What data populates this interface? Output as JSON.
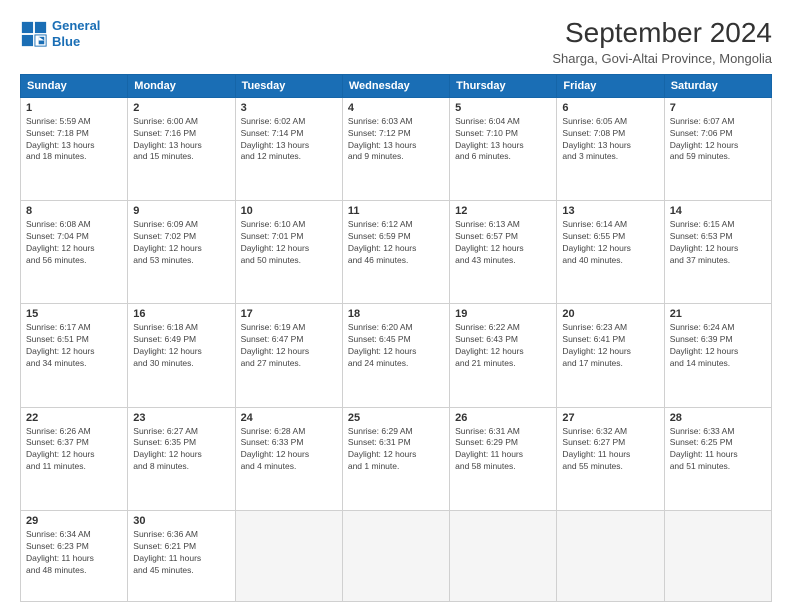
{
  "logo": {
    "line1": "General",
    "line2": "Blue"
  },
  "title": "September 2024",
  "subtitle": "Sharga, Govi-Altai Province, Mongolia",
  "headers": [
    "Sunday",
    "Monday",
    "Tuesday",
    "Wednesday",
    "Thursday",
    "Friday",
    "Saturday"
  ],
  "weeks": [
    [
      {
        "day": "1",
        "info": "Sunrise: 5:59 AM\nSunset: 7:18 PM\nDaylight: 13 hours\nand 18 minutes."
      },
      {
        "day": "2",
        "info": "Sunrise: 6:00 AM\nSunset: 7:16 PM\nDaylight: 13 hours\nand 15 minutes."
      },
      {
        "day": "3",
        "info": "Sunrise: 6:02 AM\nSunset: 7:14 PM\nDaylight: 13 hours\nand 12 minutes."
      },
      {
        "day": "4",
        "info": "Sunrise: 6:03 AM\nSunset: 7:12 PM\nDaylight: 13 hours\nand 9 minutes."
      },
      {
        "day": "5",
        "info": "Sunrise: 6:04 AM\nSunset: 7:10 PM\nDaylight: 13 hours\nand 6 minutes."
      },
      {
        "day": "6",
        "info": "Sunrise: 6:05 AM\nSunset: 7:08 PM\nDaylight: 13 hours\nand 3 minutes."
      },
      {
        "day": "7",
        "info": "Sunrise: 6:07 AM\nSunset: 7:06 PM\nDaylight: 12 hours\nand 59 minutes."
      }
    ],
    [
      {
        "day": "8",
        "info": "Sunrise: 6:08 AM\nSunset: 7:04 PM\nDaylight: 12 hours\nand 56 minutes."
      },
      {
        "day": "9",
        "info": "Sunrise: 6:09 AM\nSunset: 7:02 PM\nDaylight: 12 hours\nand 53 minutes."
      },
      {
        "day": "10",
        "info": "Sunrise: 6:10 AM\nSunset: 7:01 PM\nDaylight: 12 hours\nand 50 minutes."
      },
      {
        "day": "11",
        "info": "Sunrise: 6:12 AM\nSunset: 6:59 PM\nDaylight: 12 hours\nand 46 minutes."
      },
      {
        "day": "12",
        "info": "Sunrise: 6:13 AM\nSunset: 6:57 PM\nDaylight: 12 hours\nand 43 minutes."
      },
      {
        "day": "13",
        "info": "Sunrise: 6:14 AM\nSunset: 6:55 PM\nDaylight: 12 hours\nand 40 minutes."
      },
      {
        "day": "14",
        "info": "Sunrise: 6:15 AM\nSunset: 6:53 PM\nDaylight: 12 hours\nand 37 minutes."
      }
    ],
    [
      {
        "day": "15",
        "info": "Sunrise: 6:17 AM\nSunset: 6:51 PM\nDaylight: 12 hours\nand 34 minutes."
      },
      {
        "day": "16",
        "info": "Sunrise: 6:18 AM\nSunset: 6:49 PM\nDaylight: 12 hours\nand 30 minutes."
      },
      {
        "day": "17",
        "info": "Sunrise: 6:19 AM\nSunset: 6:47 PM\nDaylight: 12 hours\nand 27 minutes."
      },
      {
        "day": "18",
        "info": "Sunrise: 6:20 AM\nSunset: 6:45 PM\nDaylight: 12 hours\nand 24 minutes."
      },
      {
        "day": "19",
        "info": "Sunrise: 6:22 AM\nSunset: 6:43 PM\nDaylight: 12 hours\nand 21 minutes."
      },
      {
        "day": "20",
        "info": "Sunrise: 6:23 AM\nSunset: 6:41 PM\nDaylight: 12 hours\nand 17 minutes."
      },
      {
        "day": "21",
        "info": "Sunrise: 6:24 AM\nSunset: 6:39 PM\nDaylight: 12 hours\nand 14 minutes."
      }
    ],
    [
      {
        "day": "22",
        "info": "Sunrise: 6:26 AM\nSunset: 6:37 PM\nDaylight: 12 hours\nand 11 minutes."
      },
      {
        "day": "23",
        "info": "Sunrise: 6:27 AM\nSunset: 6:35 PM\nDaylight: 12 hours\nand 8 minutes."
      },
      {
        "day": "24",
        "info": "Sunrise: 6:28 AM\nSunset: 6:33 PM\nDaylight: 12 hours\nand 4 minutes."
      },
      {
        "day": "25",
        "info": "Sunrise: 6:29 AM\nSunset: 6:31 PM\nDaylight: 12 hours\nand 1 minute."
      },
      {
        "day": "26",
        "info": "Sunrise: 6:31 AM\nSunset: 6:29 PM\nDaylight: 11 hours\nand 58 minutes."
      },
      {
        "day": "27",
        "info": "Sunrise: 6:32 AM\nSunset: 6:27 PM\nDaylight: 11 hours\nand 55 minutes."
      },
      {
        "day": "28",
        "info": "Sunrise: 6:33 AM\nSunset: 6:25 PM\nDaylight: 11 hours\nand 51 minutes."
      }
    ],
    [
      {
        "day": "29",
        "info": "Sunrise: 6:34 AM\nSunset: 6:23 PM\nDaylight: 11 hours\nand 48 minutes."
      },
      {
        "day": "30",
        "info": "Sunrise: 6:36 AM\nSunset: 6:21 PM\nDaylight: 11 hours\nand 45 minutes."
      },
      {
        "day": "",
        "info": ""
      },
      {
        "day": "",
        "info": ""
      },
      {
        "day": "",
        "info": ""
      },
      {
        "day": "",
        "info": ""
      },
      {
        "day": "",
        "info": ""
      }
    ]
  ]
}
